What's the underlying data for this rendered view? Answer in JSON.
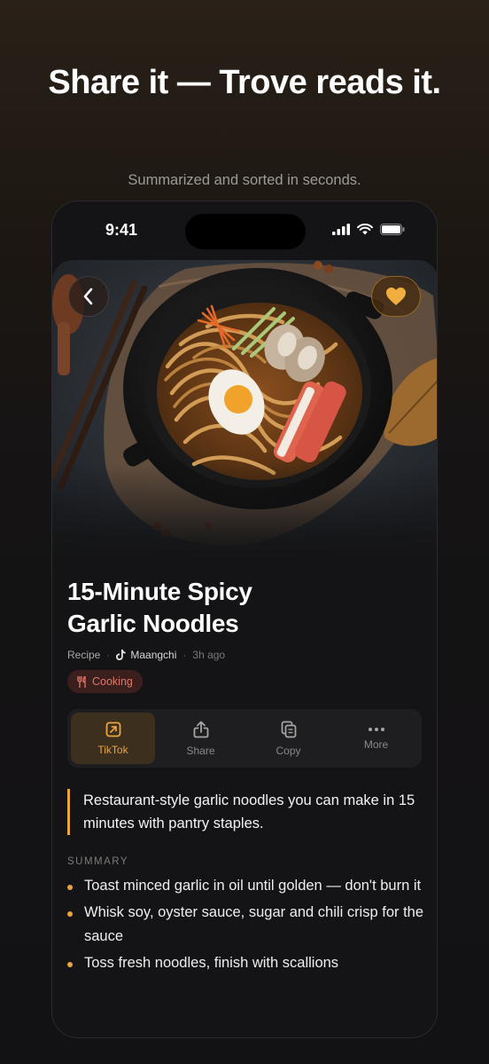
{
  "headline": "Share it — Trove reads it.",
  "subhead": "Summarized and sorted in seconds.",
  "status_bar": {
    "time": "9:41"
  },
  "recipe": {
    "title_line1": "15-Minute Spicy",
    "title_line2": "Garlic Noodles",
    "type": "Recipe",
    "author": "Maangchi",
    "posted": "3h ago",
    "tag": "Cooking"
  },
  "actions": [
    {
      "label": "TikTok",
      "icon": "external-link-icon",
      "active": true
    },
    {
      "label": "Share",
      "icon": "share-icon",
      "active": false
    },
    {
      "label": "Copy",
      "icon": "copy-icon",
      "active": false
    },
    {
      "label": "More",
      "icon": "more-dots-icon",
      "active": false
    }
  ],
  "quote": "Restaurant-style garlic noodles you can make in 15 minutes with pantry staples.",
  "summary": {
    "label": "SUMMARY",
    "items": [
      "Toast minced garlic in oil until golden — don't burn it",
      "Whisk soy, oyster sauce, sugar and chili crisp for the sauce",
      "Toss fresh noodles, finish with scallions"
    ]
  },
  "colors": {
    "accent": "#e8a43f",
    "tag_text": "#e0776a",
    "tag_bg": "#3a1f1c",
    "background": "#141416"
  }
}
